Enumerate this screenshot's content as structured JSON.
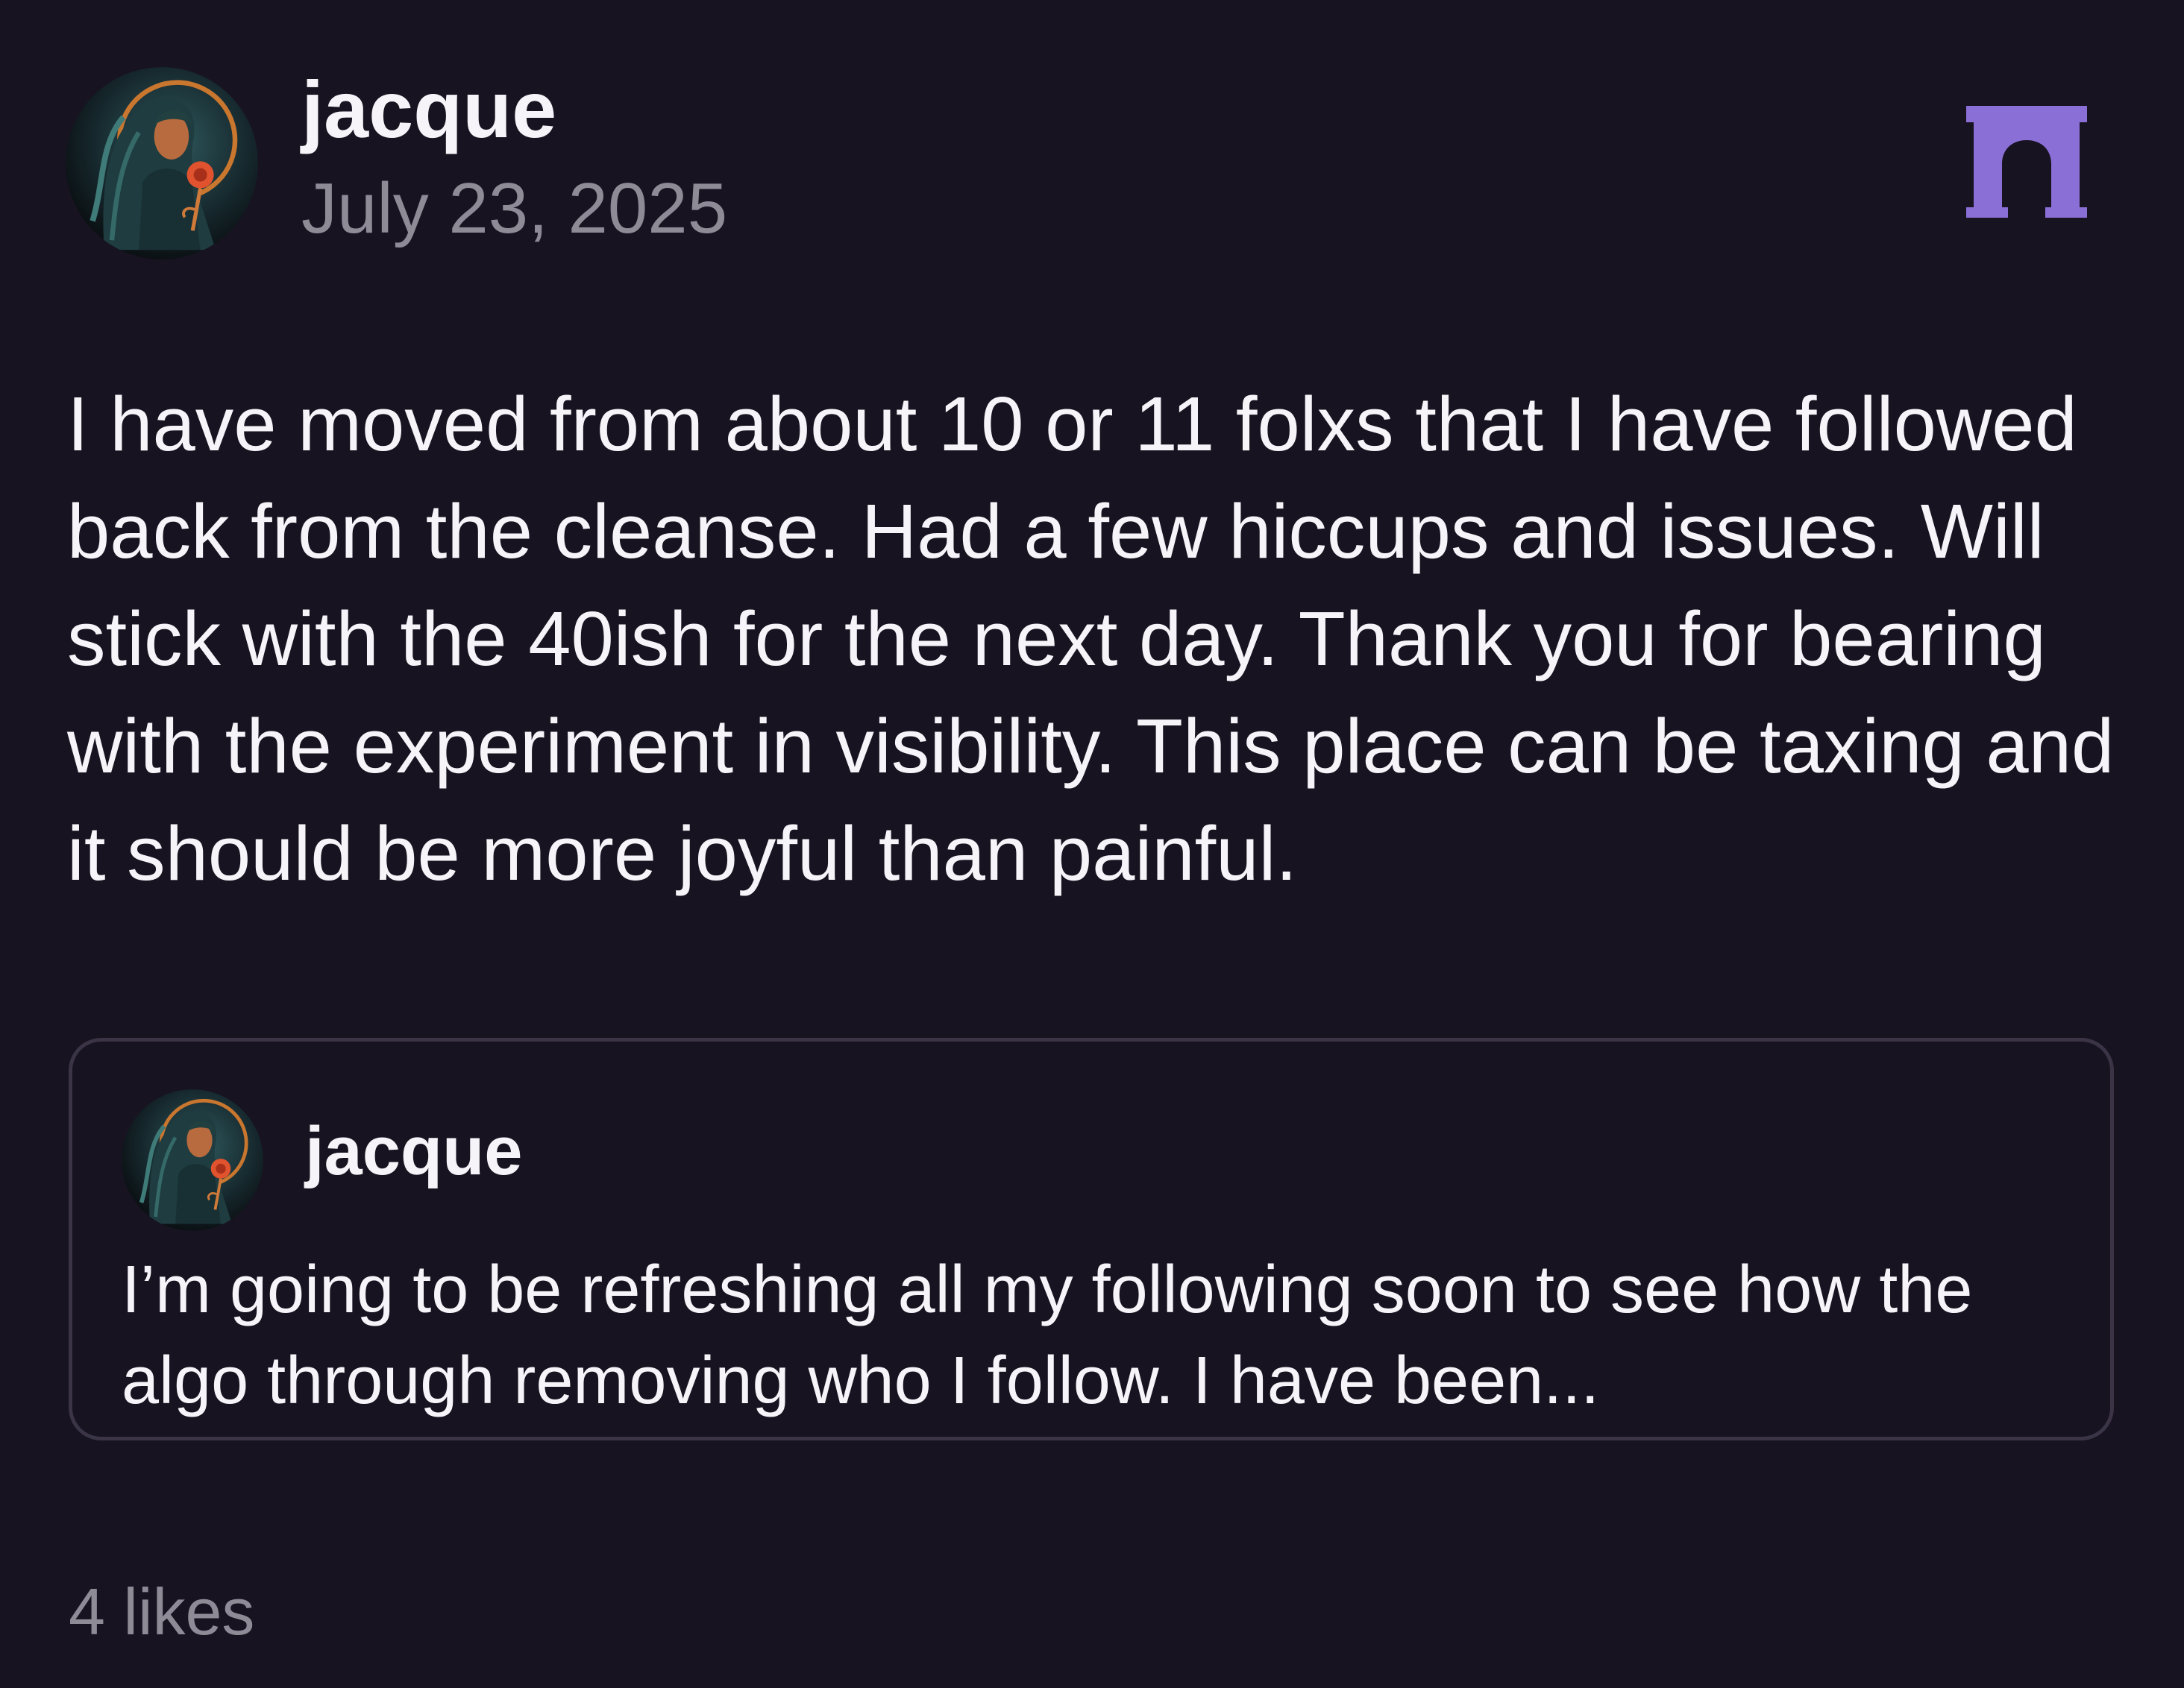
{
  "post": {
    "author": "jacque",
    "date": "July 23, 2025",
    "body": "I have moved from about 10 or 11 folxs that I have followed back from the cleanse. Had a few hiccups and issues. Will stick with the 40ish for the next day. Thank you for bearing with the experiment in visibility. This place can be taxing and it should be more joyful than painful.",
    "avatar_icon": "avatar-woman-with-rose-icon",
    "app_logo_icon": "arch-logo-icon",
    "accent_color": "#8a6fd6"
  },
  "quoted_post": {
    "author": "jacque",
    "text": "I’m going to be refreshing all my following soon to see how the algo through removing who I follow. I have been...",
    "avatar_icon": "avatar-woman-with-rose-icon"
  },
  "footer": {
    "likes": "4 likes"
  },
  "colors": {
    "background": "#171320",
    "text": "#f6f4f9",
    "muted": "#8e8a96",
    "card_border": "#3b3346"
  }
}
